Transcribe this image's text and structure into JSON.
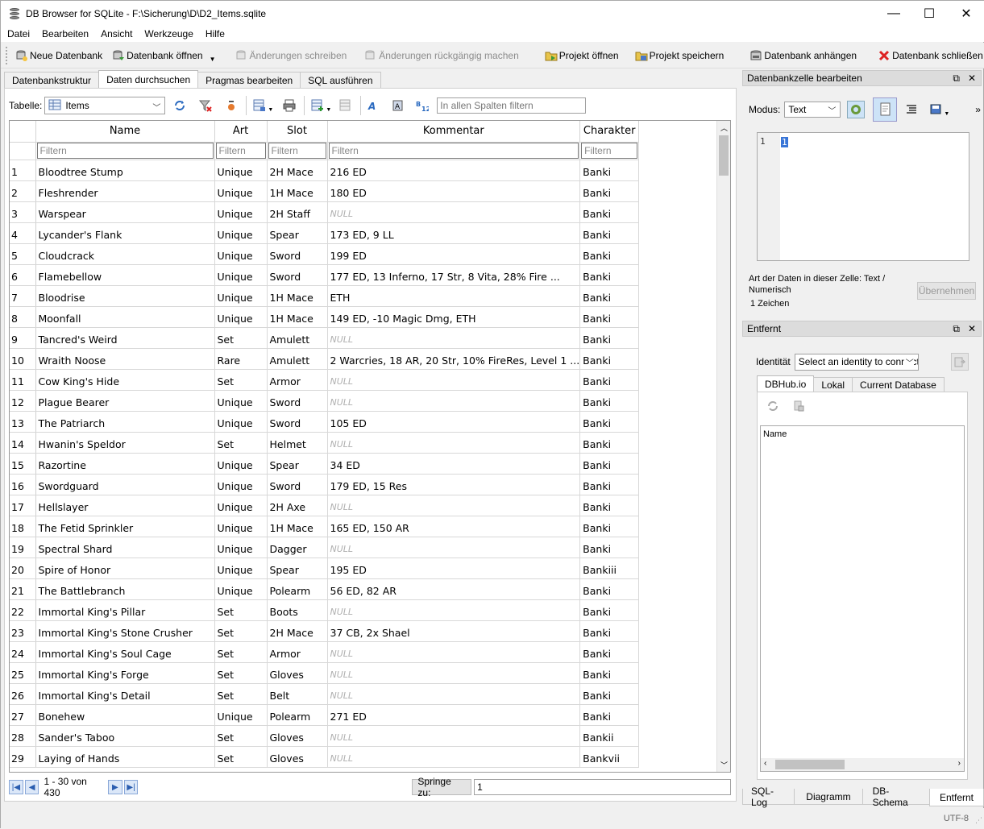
{
  "window": {
    "title": "DB Browser for SQLite - F:\\Sicherung\\D\\D2_Items.sqlite",
    "minimize": "—",
    "maximize": "☐",
    "close": "✕"
  },
  "menu": [
    "Datei",
    "Bearbeiten",
    "Ansicht",
    "Werkzeuge",
    "Hilfe"
  ],
  "toolbar": {
    "new_db": "Neue Datenbank",
    "open_db": "Datenbank öffnen",
    "write_changes": "Änderungen schreiben",
    "revert_changes": "Änderungen rückgängig machen",
    "open_project": "Projekt öffnen",
    "save_project": "Projekt speichern",
    "attach_db": "Datenbank anhängen",
    "close_db": "Datenbank schließen"
  },
  "tabs": [
    "Datenbankstruktur",
    "Daten durchsuchen",
    "Pragmas bearbeiten",
    "SQL ausführen"
  ],
  "table_bar": {
    "label": "Tabelle:",
    "table": "Items",
    "filter_placeholder": "In allen Spalten filtern"
  },
  "grid": {
    "columns": [
      "Name",
      "Art",
      "Slot",
      "Kommentar",
      "Charakter"
    ],
    "filter_placeholder": "Filtern",
    "null_text": "NULL",
    "rows": [
      [
        "1",
        "Bloodtree Stump",
        "Unique",
        "2H Mace",
        "216 ED",
        "Banki"
      ],
      [
        "2",
        "Fleshrender",
        "Unique",
        "1H Mace",
        "180 ED",
        "Banki"
      ],
      [
        "3",
        "Warspear",
        "Unique",
        "2H Staff",
        null,
        "Banki"
      ],
      [
        "4",
        "Lycander's Flank",
        "Unique",
        "Spear",
        "173 ED, 9 LL",
        "Banki"
      ],
      [
        "5",
        "Cloudcrack",
        "Unique",
        "Sword",
        "199 ED",
        "Banki"
      ],
      [
        "6",
        "Flamebellow",
        "Unique",
        "Sword",
        "177 ED, 13 Inferno, 17 Str, 8 Vita, 28% Fire ...",
        "Banki"
      ],
      [
        "7",
        "Bloodrise",
        "Unique",
        "1H Mace",
        "ETH",
        "Banki"
      ],
      [
        "8",
        "Moonfall",
        "Unique",
        "1H Mace",
        "149 ED, -10 Magic Dmg, ETH",
        "Banki"
      ],
      [
        "9",
        "Tancred's Weird",
        "Set",
        "Amulett",
        null,
        "Banki"
      ],
      [
        "10",
        "Wraith Noose",
        "Rare",
        "Amulett",
        "2 Warcries, 18 AR, 20 Str, 10% FireRes, Level 1 ...",
        "Banki"
      ],
      [
        "11",
        "Cow King's Hide",
        "Set",
        "Armor",
        null,
        "Banki"
      ],
      [
        "12",
        "Plague Bearer",
        "Unique",
        "Sword",
        null,
        "Banki"
      ],
      [
        "13",
        "The Patriarch",
        "Unique",
        "Sword",
        "105 ED",
        "Banki"
      ],
      [
        "14",
        "Hwanin's Speldor",
        "Set",
        "Helmet",
        null,
        "Banki"
      ],
      [
        "15",
        "Razortine",
        "Unique",
        "Spear",
        "34 ED",
        "Banki"
      ],
      [
        "16",
        "Swordguard",
        "Unique",
        "Sword",
        "179 ED, 15 Res",
        "Banki"
      ],
      [
        "17",
        "Hellslayer",
        "Unique",
        "2H Axe",
        null,
        "Banki"
      ],
      [
        "18",
        "The Fetid Sprinkler",
        "Unique",
        "1H Mace",
        "165 ED, 150 AR",
        "Banki"
      ],
      [
        "19",
        "Spectral Shard",
        "Unique",
        "Dagger",
        null,
        "Banki"
      ],
      [
        "20",
        "Spire of Honor",
        "Unique",
        "Spear",
        "195 ED",
        "Bankiii"
      ],
      [
        "21",
        "The Battlebranch",
        "Unique",
        "Polearm",
        "56 ED, 82 AR",
        "Banki"
      ],
      [
        "22",
        "Immortal King's Pillar",
        "Set",
        "Boots",
        null,
        "Banki"
      ],
      [
        "23",
        "Immortal King's Stone Crusher",
        "Set",
        "2H Mace",
        "37 CB, 2x Shael",
        "Banki"
      ],
      [
        "24",
        "Immortal King's Soul Cage",
        "Set",
        "Armor",
        null,
        "Banki"
      ],
      [
        "25",
        "Immortal King's Forge",
        "Set",
        "Gloves",
        null,
        "Banki"
      ],
      [
        "26",
        "Immortal King's Detail",
        "Set",
        "Belt",
        null,
        "Banki"
      ],
      [
        "27",
        "Bonehew",
        "Unique",
        "Polearm",
        "271 ED",
        "Banki"
      ],
      [
        "28",
        "Sander's Taboo",
        "Set",
        "Gloves",
        null,
        "Bankii"
      ],
      [
        "29",
        "Laying of Hands",
        "Set",
        "Gloves",
        null,
        "Bankvii"
      ]
    ]
  },
  "pager": {
    "range": "1 - 30 von 430",
    "goto_label": "Springe zu:",
    "goto_value": "1"
  },
  "edit_cell": {
    "title": "Datenbankzelle bearbeiten",
    "mode_label": "Modus:",
    "mode_value": "Text",
    "line_no": "1",
    "content": "1",
    "type_info": "Art der Daten in dieser Zelle: Text / Numerisch",
    "char_count": "1 Zeichen",
    "apply": "Übernehmen"
  },
  "remote": {
    "title": "Entfernt",
    "identity_label": "Identität",
    "identity_value": "Select an identity to connect",
    "tabs": [
      "DBHub.io",
      "Lokal",
      "Current Database"
    ],
    "list_header": "Name"
  },
  "bottom_tabs": [
    "SQL-Log",
    "Diagramm",
    "DB-Schema",
    "Entfernt"
  ],
  "status": {
    "encoding": "UTF-8"
  }
}
